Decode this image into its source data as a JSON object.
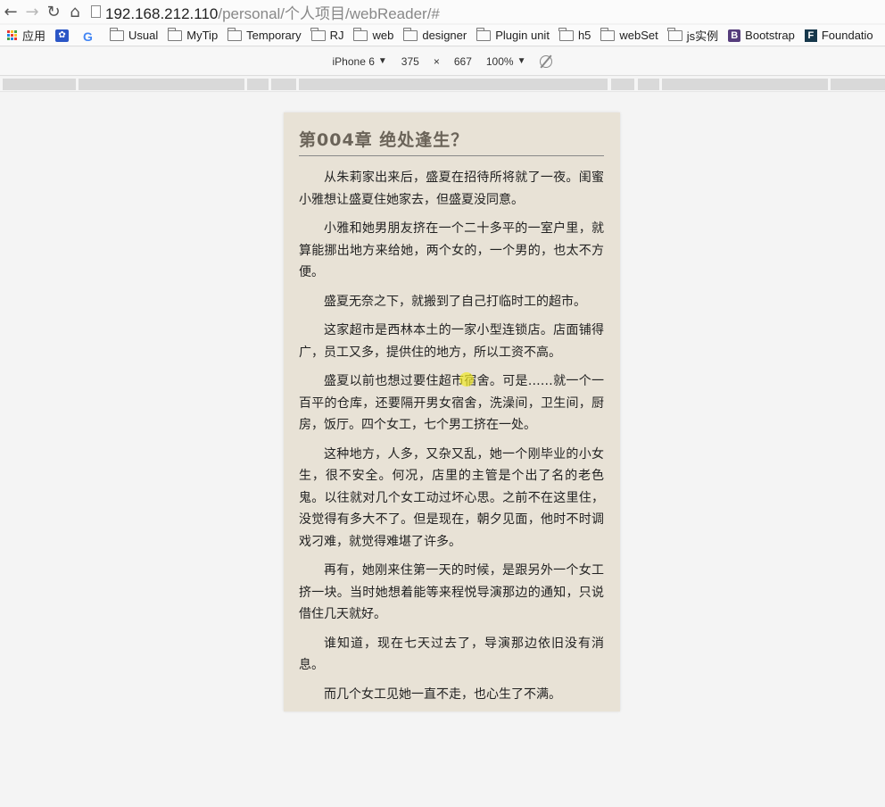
{
  "browser": {
    "url_host": "192.168.212.110",
    "url_path": "/personal/个人项目/webReader/#",
    "bookmarks": [
      {
        "label": "应用",
        "icon": "apps-grid-icon"
      },
      {
        "label": "",
        "icon": "paw-icon"
      },
      {
        "label": "",
        "icon": "google-icon"
      },
      {
        "label": "Usual",
        "icon": "folder-icon"
      },
      {
        "label": "MyTip",
        "icon": "folder-icon"
      },
      {
        "label": "Temporary",
        "icon": "folder-icon"
      },
      {
        "label": "RJ",
        "icon": "folder-icon"
      },
      {
        "label": "web",
        "icon": "folder-icon"
      },
      {
        "label": "designer",
        "icon": "folder-icon"
      },
      {
        "label": "Plugin unit",
        "icon": "folder-icon"
      },
      {
        "label": "h5",
        "icon": "folder-icon"
      },
      {
        "label": "webSet",
        "icon": "folder-icon"
      },
      {
        "label": "js实例",
        "icon": "folder-icon"
      },
      {
        "label": "Bootstrap",
        "icon": "bootstrap-icon"
      },
      {
        "label": "Foundatio",
        "icon": "foundation-icon"
      }
    ]
  },
  "device_toolbar": {
    "device": "iPhone 6",
    "width": "375",
    "times": "×",
    "height": "667",
    "zoom": "100%"
  },
  "reader": {
    "chapter_title": "第004章 绝处逢生？",
    "paragraphs": [
      "从朱莉家出来后，盛夏在招待所将就了一夜。闺蜜小雅想让盛夏住她家去，但盛夏没同意。",
      "小雅和她男朋友挤在一个二十多平的一室户里，就算能挪出地方来给她，两个女的，一个男的，也太不方便。",
      "盛夏无奈之下，就搬到了自己打临时工的超市。",
      "这家超市是西林本土的一家小型连锁店。店面铺得广，员工又多，提供住的地方，所以工资不高。",
      "盛夏以前也想过要住超市宿舍。可是……就一个一百平的仓库，还要隔开男女宿舍，洗澡间，卫生间，厨房，饭厅。四个女工，七个男工挤在一处。",
      "这种地方，人多，又杂又乱，她一个刚毕业的小女生，很不安全。何况，店里的主管是个出了名的老色鬼。以往就对几个女工动过坏心思。之前不在这里住，没觉得有多大不了。但是现在，朝夕见面，他时不时调戏刁难，就觉得难堪了许多。",
      "再有，她刚来住第一天的时候，是跟另外一个女工挤一块。当时她想着能等来程悦导演那边的通知，只说借住几天就好。",
      "谁知道，现在七天过去了，导演那边依旧没有消息。",
      "而几个女工见她一直不走，也心生了不满。"
    ]
  }
}
